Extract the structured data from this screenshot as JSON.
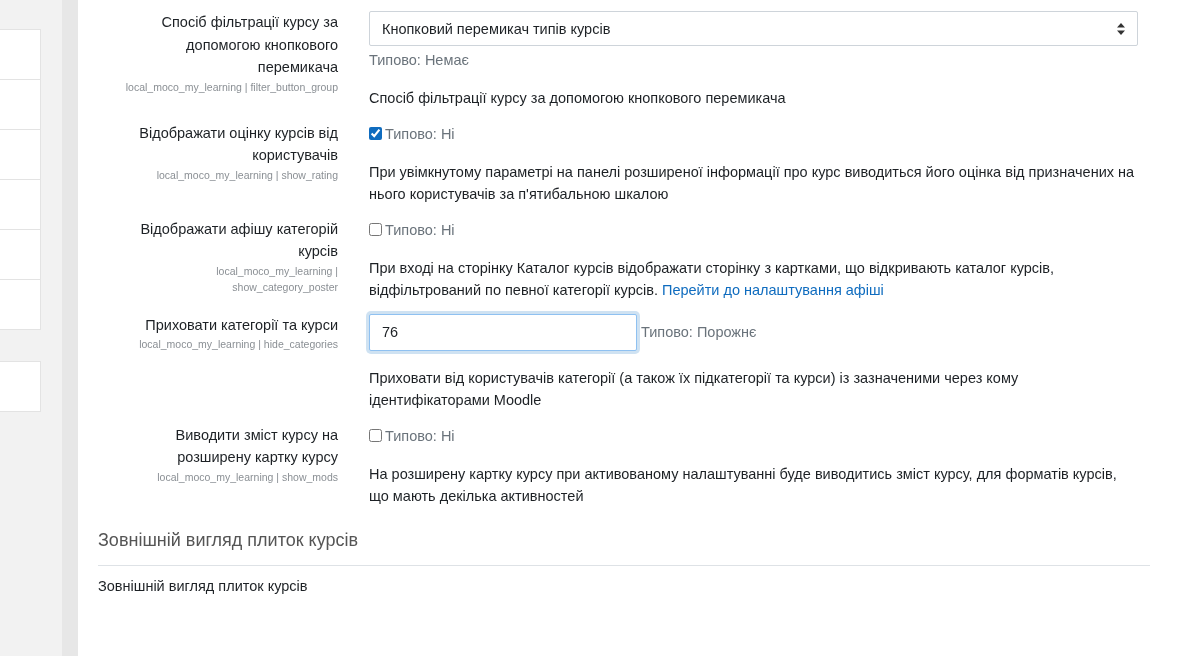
{
  "settings": [
    {
      "kind": "select",
      "label": "Спосіб фільтрації курсу за допомогою кнопкового перемикача",
      "setting_id": "local_moco_my_learning | filter_button_group",
      "value": "Кнопковий перемикач типів курсів",
      "default": "Типово: Немає",
      "description": "Спосіб фільтрації курсу за допомогою кнопкового перемикача"
    },
    {
      "kind": "checkbox",
      "label": "Відображати оцінку курсів від користувачів",
      "setting_id": "local_moco_my_learning | show_rating",
      "checked": true,
      "default": "Типово: Ні",
      "description": "При увімкнутому параметрі на панелі розширеної інформації про курс виводиться його оцінка від призначених на нього користувачів за п'ятибальною шкалою"
    },
    {
      "kind": "checkbox",
      "label": "Відображати афішу категорій курсів",
      "setting_id": "local_moco_my_learning | show_category_poster",
      "checked": false,
      "default": "Типово: Ні",
      "description": "При вході на сторінку Каталог курсів відображати сторінку з картками, що відкривають каталог курсів, відфільтрований по певної категорії курсів.",
      "description_link": "Перейти до налаштування афіші"
    },
    {
      "kind": "text",
      "label": "Приховати категорії та курси",
      "setting_id": "local_moco_my_learning | hide_categories",
      "value": "76",
      "default": "Типово: Порожнє",
      "description": "Приховати від користувачів категорії (а також їх підкатегорії та курси) із зазначеними через кому ідентифікаторами Moodle"
    },
    {
      "kind": "checkbox",
      "label": "Виводити зміст курсу на розширену картку курсу",
      "setting_id": "local_moco_my_learning | show_mods",
      "checked": false,
      "default": "Типово: Ні",
      "description": "На розширену картку курсу при активованому налаштуванні буде виводитись зміст курсу, для форматів курсів, що мають декілька активностей"
    }
  ],
  "section": {
    "heading": "Зовнішній вигляд плиток курсів",
    "text": "Зовнішній вигляд плиток курсів"
  }
}
